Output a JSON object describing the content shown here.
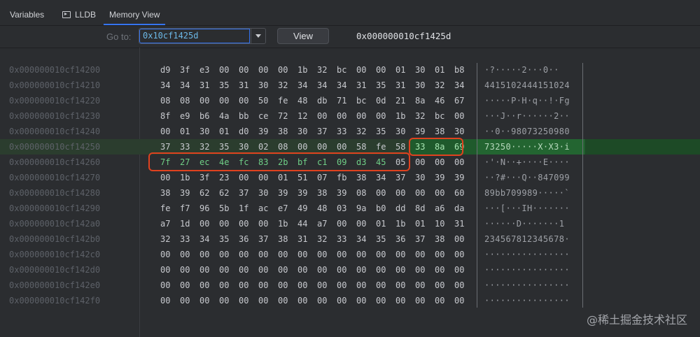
{
  "tabs": [
    {
      "label": "Variables"
    },
    {
      "label": "LLDB"
    },
    {
      "label": "Memory View"
    }
  ],
  "toolbar": {
    "goto_label": "Go to:",
    "address_value": "0x10cf1425d",
    "view_label": "View",
    "address_display": "0x000000010cf1425d"
  },
  "rows": [
    {
      "addr": "0x000000010cf14200",
      "bytes": [
        "d9",
        "3f",
        "e3",
        "00",
        "00",
        "00",
        "00",
        "1b",
        "32",
        "bc",
        "00",
        "00",
        "01",
        "30",
        "01",
        "b8"
      ],
      "ascii": "·?·····2···0··"
    },
    {
      "addr": "0x000000010cf14210",
      "bytes": [
        "34",
        "34",
        "31",
        "35",
        "31",
        "30",
        "32",
        "34",
        "34",
        "34",
        "31",
        "35",
        "31",
        "30",
        "32",
        "34"
      ],
      "ascii": "4415102444151024"
    },
    {
      "addr": "0x000000010cf14220",
      "bytes": [
        "08",
        "08",
        "00",
        "00",
        "00",
        "50",
        "fe",
        "48",
        "db",
        "71",
        "bc",
        "0d",
        "21",
        "8a",
        "46",
        "67"
      ],
      "ascii": "·····P·H·q··!·Fg"
    },
    {
      "addr": "0x000000010cf14230",
      "bytes": [
        "8f",
        "e9",
        "b6",
        "4a",
        "bb",
        "ce",
        "72",
        "12",
        "00",
        "00",
        "00",
        "00",
        "1b",
        "32",
        "bc",
        "00"
      ],
      "ascii": "···J··r······2··"
    },
    {
      "addr": "0x000000010cf14240",
      "bytes": [
        "00",
        "01",
        "30",
        "01",
        "d0",
        "39",
        "38",
        "30",
        "37",
        "33",
        "32",
        "35",
        "30",
        "39",
        "38",
        "30"
      ],
      "ascii": "··0··98073250980"
    },
    {
      "addr": "0x000000010cf14250",
      "bytes": [
        "37",
        "33",
        "32",
        "35",
        "30",
        "02",
        "08",
        "00",
        "00",
        "00",
        "58",
        "fe",
        "58",
        "33",
        "8a",
        "69"
      ],
      "ascii": "73250·····X·X3·i"
    },
    {
      "addr": "0x000000010cf14260",
      "bytes": [
        "7f",
        "27",
        "ec",
        "4e",
        "fc",
        "83",
        "2b",
        "bf",
        "c1",
        "09",
        "d3",
        "45",
        "05",
        "00",
        "00",
        "00"
      ],
      "ascii": "·'·N··+····E····"
    },
    {
      "addr": "0x000000010cf14270",
      "bytes": [
        "00",
        "1b",
        "3f",
        "23",
        "00",
        "00",
        "01",
        "51",
        "07",
        "fb",
        "38",
        "34",
        "37",
        "30",
        "39",
        "39"
      ],
      "ascii": "··?#···Q··847099"
    },
    {
      "addr": "0x000000010cf14280",
      "bytes": [
        "38",
        "39",
        "62",
        "62",
        "37",
        "30",
        "39",
        "39",
        "38",
        "39",
        "08",
        "00",
        "00",
        "00",
        "00",
        "60"
      ],
      "ascii": "89bb709989·····`"
    },
    {
      "addr": "0x000000010cf14290",
      "bytes": [
        "fe",
        "f7",
        "96",
        "5b",
        "1f",
        "ac",
        "e7",
        "49",
        "48",
        "03",
        "9a",
        "b0",
        "dd",
        "8d",
        "a6",
        "da"
      ],
      "ascii": "···[···IH·······"
    },
    {
      "addr": "0x000000010cf142a0",
      "bytes": [
        "a7",
        "1d",
        "00",
        "00",
        "00",
        "00",
        "1b",
        "44",
        "a7",
        "00",
        "00",
        "01",
        "1b",
        "01",
        "10",
        "31"
      ],
      "ascii": "······D·······1"
    },
    {
      "addr": "0x000000010cf142b0",
      "bytes": [
        "32",
        "33",
        "34",
        "35",
        "36",
        "37",
        "38",
        "31",
        "32",
        "33",
        "34",
        "35",
        "36",
        "37",
        "38",
        "00"
      ],
      "ascii": "234567812345678·"
    },
    {
      "addr": "0x000000010cf142c0",
      "bytes": [
        "00",
        "00",
        "00",
        "00",
        "00",
        "00",
        "00",
        "00",
        "00",
        "00",
        "00",
        "00",
        "00",
        "00",
        "00",
        "00"
      ],
      "ascii": "················"
    },
    {
      "addr": "0x000000010cf142d0",
      "bytes": [
        "00",
        "00",
        "00",
        "00",
        "00",
        "00",
        "00",
        "00",
        "00",
        "00",
        "00",
        "00",
        "00",
        "00",
        "00",
        "00"
      ],
      "ascii": "················"
    },
    {
      "addr": "0x000000010cf142e0",
      "bytes": [
        "00",
        "00",
        "00",
        "00",
        "00",
        "00",
        "00",
        "00",
        "00",
        "00",
        "00",
        "00",
        "00",
        "00",
        "00",
        "00"
      ],
      "ascii": "················"
    },
    {
      "addr": "0x000000010cf142f0",
      "bytes": [
        "00",
        "00",
        "00",
        "00",
        "00",
        "00",
        "00",
        "00",
        "00",
        "00",
        "00",
        "00",
        "00",
        "00",
        "00",
        "00"
      ],
      "ascii": "················"
    }
  ],
  "highlight": {
    "row_index": 5,
    "bright_bytes_from": 13,
    "green_row_index": 6,
    "green_bytes_to": 12
  },
  "watermark": "@稀土掘金技术社区",
  "colors": {
    "accent": "#3574f0",
    "highlight_green": "#1f5a2c",
    "annotation_red": "#e0421f"
  }
}
